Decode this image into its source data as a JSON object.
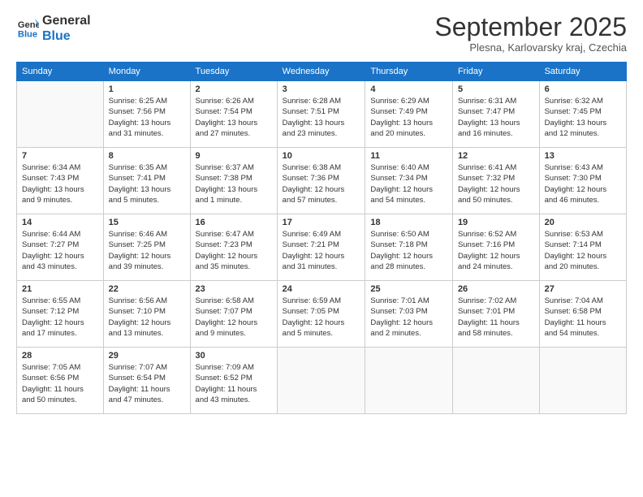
{
  "logo": {
    "line1": "General",
    "line2": "Blue"
  },
  "title": "September 2025",
  "subtitle": "Plesna, Karlovarsky kraj, Czechia",
  "days_header": [
    "Sunday",
    "Monday",
    "Tuesday",
    "Wednesday",
    "Thursday",
    "Friday",
    "Saturday"
  ],
  "weeks": [
    [
      {
        "day": "",
        "lines": [],
        "empty": true
      },
      {
        "day": "1",
        "lines": [
          "Sunrise: 6:25 AM",
          "Sunset: 7:56 PM",
          "Daylight: 13 hours",
          "and 31 minutes."
        ]
      },
      {
        "day": "2",
        "lines": [
          "Sunrise: 6:26 AM",
          "Sunset: 7:54 PM",
          "Daylight: 13 hours",
          "and 27 minutes."
        ]
      },
      {
        "day": "3",
        "lines": [
          "Sunrise: 6:28 AM",
          "Sunset: 7:51 PM",
          "Daylight: 13 hours",
          "and 23 minutes."
        ]
      },
      {
        "day": "4",
        "lines": [
          "Sunrise: 6:29 AM",
          "Sunset: 7:49 PM",
          "Daylight: 13 hours",
          "and 20 minutes."
        ]
      },
      {
        "day": "5",
        "lines": [
          "Sunrise: 6:31 AM",
          "Sunset: 7:47 PM",
          "Daylight: 13 hours",
          "and 16 minutes."
        ]
      },
      {
        "day": "6",
        "lines": [
          "Sunrise: 6:32 AM",
          "Sunset: 7:45 PM",
          "Daylight: 13 hours",
          "and 12 minutes."
        ]
      }
    ],
    [
      {
        "day": "7",
        "lines": [
          "Sunrise: 6:34 AM",
          "Sunset: 7:43 PM",
          "Daylight: 13 hours",
          "and 9 minutes."
        ]
      },
      {
        "day": "8",
        "lines": [
          "Sunrise: 6:35 AM",
          "Sunset: 7:41 PM",
          "Daylight: 13 hours",
          "and 5 minutes."
        ]
      },
      {
        "day": "9",
        "lines": [
          "Sunrise: 6:37 AM",
          "Sunset: 7:38 PM",
          "Daylight: 13 hours",
          "and 1 minute."
        ]
      },
      {
        "day": "10",
        "lines": [
          "Sunrise: 6:38 AM",
          "Sunset: 7:36 PM",
          "Daylight: 12 hours",
          "and 57 minutes."
        ]
      },
      {
        "day": "11",
        "lines": [
          "Sunrise: 6:40 AM",
          "Sunset: 7:34 PM",
          "Daylight: 12 hours",
          "and 54 minutes."
        ]
      },
      {
        "day": "12",
        "lines": [
          "Sunrise: 6:41 AM",
          "Sunset: 7:32 PM",
          "Daylight: 12 hours",
          "and 50 minutes."
        ]
      },
      {
        "day": "13",
        "lines": [
          "Sunrise: 6:43 AM",
          "Sunset: 7:30 PM",
          "Daylight: 12 hours",
          "and 46 minutes."
        ]
      }
    ],
    [
      {
        "day": "14",
        "lines": [
          "Sunrise: 6:44 AM",
          "Sunset: 7:27 PM",
          "Daylight: 12 hours",
          "and 43 minutes."
        ]
      },
      {
        "day": "15",
        "lines": [
          "Sunrise: 6:46 AM",
          "Sunset: 7:25 PM",
          "Daylight: 12 hours",
          "and 39 minutes."
        ]
      },
      {
        "day": "16",
        "lines": [
          "Sunrise: 6:47 AM",
          "Sunset: 7:23 PM",
          "Daylight: 12 hours",
          "and 35 minutes."
        ]
      },
      {
        "day": "17",
        "lines": [
          "Sunrise: 6:49 AM",
          "Sunset: 7:21 PM",
          "Daylight: 12 hours",
          "and 31 minutes."
        ]
      },
      {
        "day": "18",
        "lines": [
          "Sunrise: 6:50 AM",
          "Sunset: 7:18 PM",
          "Daylight: 12 hours",
          "and 28 minutes."
        ]
      },
      {
        "day": "19",
        "lines": [
          "Sunrise: 6:52 AM",
          "Sunset: 7:16 PM",
          "Daylight: 12 hours",
          "and 24 minutes."
        ]
      },
      {
        "day": "20",
        "lines": [
          "Sunrise: 6:53 AM",
          "Sunset: 7:14 PM",
          "Daylight: 12 hours",
          "and 20 minutes."
        ]
      }
    ],
    [
      {
        "day": "21",
        "lines": [
          "Sunrise: 6:55 AM",
          "Sunset: 7:12 PM",
          "Daylight: 12 hours",
          "and 17 minutes."
        ]
      },
      {
        "day": "22",
        "lines": [
          "Sunrise: 6:56 AM",
          "Sunset: 7:10 PM",
          "Daylight: 12 hours",
          "and 13 minutes."
        ]
      },
      {
        "day": "23",
        "lines": [
          "Sunrise: 6:58 AM",
          "Sunset: 7:07 PM",
          "Daylight: 12 hours",
          "and 9 minutes."
        ]
      },
      {
        "day": "24",
        "lines": [
          "Sunrise: 6:59 AM",
          "Sunset: 7:05 PM",
          "Daylight: 12 hours",
          "and 5 minutes."
        ]
      },
      {
        "day": "25",
        "lines": [
          "Sunrise: 7:01 AM",
          "Sunset: 7:03 PM",
          "Daylight: 12 hours",
          "and 2 minutes."
        ]
      },
      {
        "day": "26",
        "lines": [
          "Sunrise: 7:02 AM",
          "Sunset: 7:01 PM",
          "Daylight: 11 hours",
          "and 58 minutes."
        ]
      },
      {
        "day": "27",
        "lines": [
          "Sunrise: 7:04 AM",
          "Sunset: 6:58 PM",
          "Daylight: 11 hours",
          "and 54 minutes."
        ]
      }
    ],
    [
      {
        "day": "28",
        "lines": [
          "Sunrise: 7:05 AM",
          "Sunset: 6:56 PM",
          "Daylight: 11 hours",
          "and 50 minutes."
        ]
      },
      {
        "day": "29",
        "lines": [
          "Sunrise: 7:07 AM",
          "Sunset: 6:54 PM",
          "Daylight: 11 hours",
          "and 47 minutes."
        ]
      },
      {
        "day": "30",
        "lines": [
          "Sunrise: 7:09 AM",
          "Sunset: 6:52 PM",
          "Daylight: 11 hours",
          "and 43 minutes."
        ]
      },
      {
        "day": "",
        "lines": [],
        "empty": true
      },
      {
        "day": "",
        "lines": [],
        "empty": true
      },
      {
        "day": "",
        "lines": [],
        "empty": true
      },
      {
        "day": "",
        "lines": [],
        "empty": true
      }
    ]
  ]
}
